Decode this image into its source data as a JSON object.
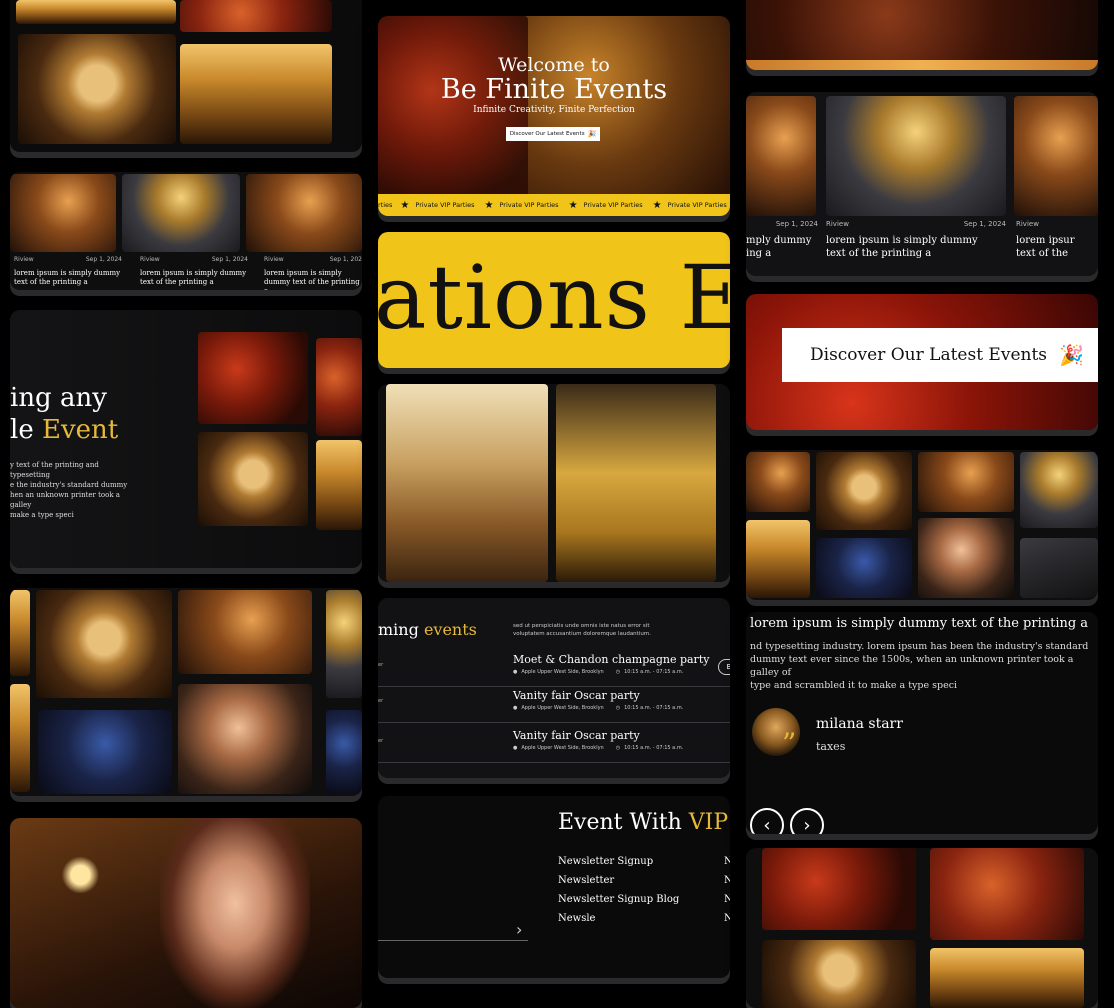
{
  "hero": {
    "welcome": "Welcome to",
    "brand": "Be Finite Events",
    "tagline": "Infinite Creativity, Finite Perfection",
    "cta": "Discover Our Latest Events",
    "ticker": [
      "rties",
      "Private VIP Parties",
      "Private VIP Parties",
      "Private VIP Parties",
      "Private VIP Parties"
    ]
  },
  "marquee": {
    "text": "ations E"
  },
  "blog": {
    "posts": [
      {
        "category": "Riview",
        "date": "Sep 1, 2024",
        "title": "lorem ipsum is simply dummy text of the printing a"
      },
      {
        "category": "Riview",
        "date": "Sep 1, 2024",
        "title": "lorem ipsum is simply dummy text of the printing a"
      },
      {
        "category": "Riview",
        "date": "Sep 1, 202",
        "title": "lorem ipsum is simply dummy text of the printing a"
      }
    ],
    "zoom": [
      {
        "category": "",
        "date": "Sep 1, 2024",
        "title": "mply dummy\ning a"
      },
      {
        "category": "Riview",
        "date": "Sep 1, 2024",
        "title": "lorem ipsum is simply dummy\ntext of the printing a"
      },
      {
        "category": "Riview",
        "date": "",
        "title": "lorem ipsur\ntext of the"
      }
    ]
  },
  "about": {
    "line1": "ing any",
    "line2_pre": "le",
    "line2_accent": "Event",
    "body": "y text of the printing and typesetting\ne the industry's standard dummy\nhen an unknown printer took a galley\nmake a type speci"
  },
  "upcoming": {
    "title_pre": "ming",
    "title_accent": "events",
    "intro": "sed ut perspiciatis unde omnis iste natus error sit\nvoluptatem accusantium doloremque laudantium.",
    "events": [
      {
        "left": "er",
        "name": "Moet & Chandon champagne party",
        "location": "Apple Upper West Side, Brooklyn",
        "time": "10:15 a.m. - 07:15 a.m.",
        "button": "B"
      },
      {
        "left": "er",
        "name": "Vanity fair Oscar party",
        "location": "Apple Upper West Side, Brooklyn",
        "time": "10:15 a.m. - 07:15 a.m.",
        "button": ""
      },
      {
        "left": "er",
        "name": "Vanity fair Oscar party",
        "location": "Apple Upper West Side, Brooklyn",
        "time": "10:15 a.m. - 07:15 a.m.",
        "button": ""
      }
    ]
  },
  "footer": {
    "title_pre": "Event With",
    "title_accent": "VIP",
    "links": [
      "Newsletter Signup",
      "Newsletter",
      "Newsletter Signup Blog",
      "Newsle"
    ],
    "links_right": [
      "N",
      "N",
      "N",
      "N"
    ]
  },
  "cta_zoom": {
    "label": "Discover Our Latest Events"
  },
  "testimonial": {
    "quote_top": "lorem ipsum is simply dummy text of the printing a",
    "quote_body": "nd typesetting industry. lorem ipsum has been the industry's standard\ndummy text ever since the 1500s, when an unknown printer took a galley of\ntype and scrambled it to make a type speci",
    "name": "milana starr",
    "role": "taxes",
    "prev": "‹",
    "next": "›"
  },
  "colors": {
    "accent": "#e6b93a",
    "ticker_bg": "#f0c419",
    "background": "#000000",
    "card": "#0e0e0f"
  }
}
